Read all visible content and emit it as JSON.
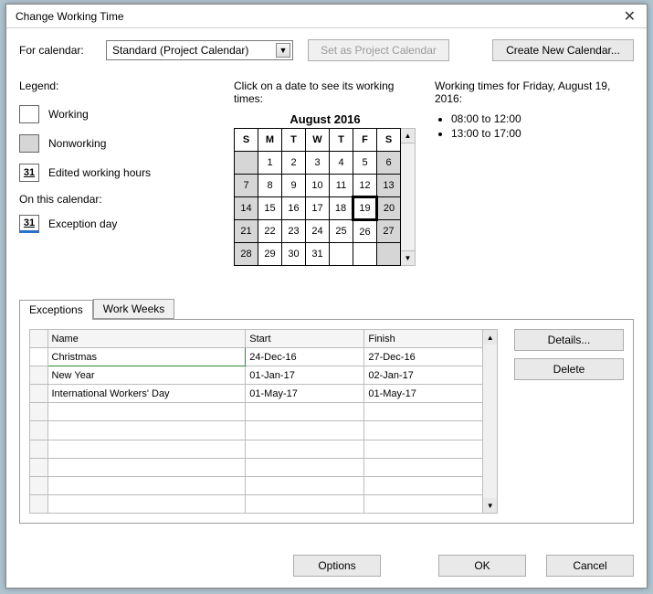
{
  "title": "Change Working Time",
  "forCalendarLabel": "For calendar:",
  "selectedCalendar": "Standard (Project Calendar)",
  "setProjectBtn": "Set as Project Calendar",
  "createBtn": "Create New Calendar...",
  "legend": {
    "heading": "Legend:",
    "working": "Working",
    "nonworking": "Nonworking",
    "editedNum": "31",
    "edited": "Edited working hours",
    "onThis": "On this calendar:",
    "excNum": "31",
    "exc": "Exception day"
  },
  "calHint": "Click on a date to see its working times:",
  "calTitle": "August 2016",
  "dow": [
    "S",
    "M",
    "T",
    "W",
    "T",
    "F",
    "S"
  ],
  "weeks": [
    [
      "",
      "1",
      "2",
      "3",
      "4",
      "5",
      "6"
    ],
    [
      "7",
      "8",
      "9",
      "10",
      "11",
      "12",
      "13"
    ],
    [
      "14",
      "15",
      "16",
      "17",
      "18",
      "19",
      "20"
    ],
    [
      "21",
      "22",
      "23",
      "24",
      "25",
      "26",
      "27"
    ],
    [
      "28",
      "29",
      "30",
      "31",
      "",
      "",
      ""
    ]
  ],
  "selectedDay": "19",
  "workingFor": "Working times for Friday, August 19, 2016:",
  "workingTimes": [
    "08:00 to 12:00",
    "13:00 to 17:00"
  ],
  "tabs": {
    "exceptions": "Exceptions",
    "workweeks": "Work Weeks"
  },
  "excHeaders": {
    "name": "Name",
    "start": "Start",
    "finish": "Finish"
  },
  "exceptions": [
    {
      "name": "Christmas",
      "start": "24-Dec-16",
      "finish": "27-Dec-16"
    },
    {
      "name": "New Year",
      "start": "01-Jan-17",
      "finish": "02-Jan-17"
    },
    {
      "name": "International Workers' Day",
      "start": "01-May-17",
      "finish": "01-May-17"
    }
  ],
  "detailsBtn": "Details...",
  "deleteBtn": "Delete",
  "optionsBtn": "Options",
  "okBtn": "OK",
  "cancelBtn": "Cancel"
}
